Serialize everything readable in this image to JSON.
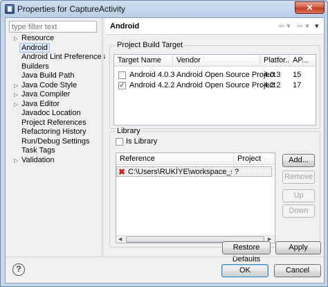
{
  "window": {
    "title": "Properties for CaptureActivity",
    "close": "✕"
  },
  "filter": {
    "placeholder": "type filter text"
  },
  "tree": [
    {
      "label": "Resource",
      "expandable": true
    },
    {
      "label": "Android",
      "selected": true
    },
    {
      "label": "Android Lint Preferences"
    },
    {
      "label": "Builders"
    },
    {
      "label": "Java Build Path"
    },
    {
      "label": "Java Code Style",
      "expandable": true
    },
    {
      "label": "Java Compiler",
      "expandable": true
    },
    {
      "label": "Java Editor",
      "expandable": true
    },
    {
      "label": "Javadoc Location"
    },
    {
      "label": "Project References"
    },
    {
      "label": "Refactoring History"
    },
    {
      "label": "Run/Debug Settings"
    },
    {
      "label": "Task Tags"
    },
    {
      "label": "Validation",
      "expandable": true
    }
  ],
  "page": {
    "title": "Android",
    "nav_back": "⇦ ▾",
    "nav_forward": "⇨ ▾",
    "nav_menu": "▾"
  },
  "build_target": {
    "label": "Project Build Target",
    "columns": [
      "Target Name",
      "Vendor",
      "Platfor...",
      "AP..."
    ],
    "rows": [
      {
        "checked": false,
        "name": "Android 4.0.3",
        "vendor": "Android Open Source Project",
        "platform": "4.0.3",
        "api": "15"
      },
      {
        "checked": true,
        "name": "Android 4.2.2",
        "vendor": "Android Open Source Project",
        "platform": "4.2.2",
        "api": "17"
      }
    ]
  },
  "library": {
    "label": "Library",
    "is_library_label": "Is Library",
    "is_library_checked": false,
    "columns": [
      "Reference",
      "Project"
    ],
    "rows": [
      {
        "reference": "C:\\Users\\RUKİYE\\workspace_subhi\\...",
        "project": "?"
      }
    ],
    "buttons": {
      "add": "Add...",
      "remove": "Remove",
      "up": "Up",
      "down": "Down"
    }
  },
  "actions": {
    "restore": "Restore Defaults",
    "apply": "Apply",
    "ok": "OK",
    "cancel": "Cancel"
  },
  "help": "?"
}
